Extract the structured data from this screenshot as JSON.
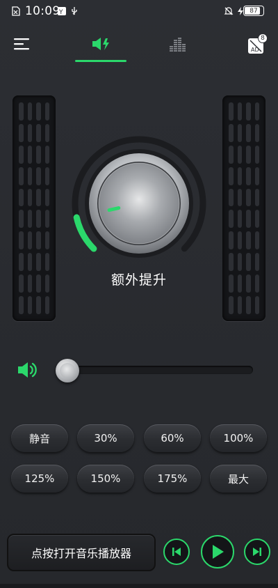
{
  "status_bar": {
    "time": "10:09",
    "battery": "87"
  },
  "nav": {
    "tabs": [
      {
        "icon": "volume-boost-icon",
        "active": true
      },
      {
        "icon": "equalizer-icon",
        "active": false
      }
    ],
    "ad_badge_count": "8",
    "ad_label": "AD"
  },
  "booster": {
    "title": "额外提升",
    "level_fraction": 0.12
  },
  "volume": {
    "level_fraction": 0.0
  },
  "presets": {
    "row1": [
      "静音",
      "30%",
      "60%",
      "100%"
    ],
    "row2": [
      "125%",
      "150%",
      "175%",
      "最大"
    ]
  },
  "player": {
    "open_label": "点按打开音乐播放器"
  },
  "colors": {
    "accent": "#2bd86b",
    "background": "#2a2c31"
  }
}
